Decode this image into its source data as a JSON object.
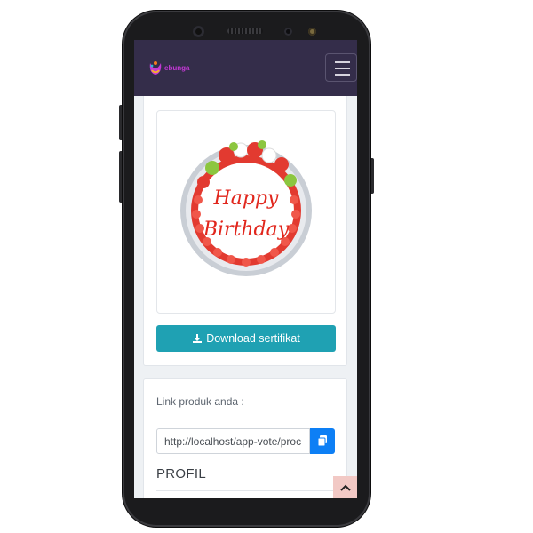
{
  "app": {
    "brand": "ebunga",
    "brand_color": "#c438d6",
    "navbar_color": "#342d4a",
    "menu_icon": "hamburger-icon"
  },
  "certificate": {
    "image_text": "Happy Birthday",
    "download_label": "Download sertifikat",
    "download_icon": "download-icon",
    "button_color": "#1fa1b3"
  },
  "product_link": {
    "label": "Link produk anda :",
    "url_value": "http://localhost/app-vote/proc",
    "copy_icon": "copy-icon",
    "copy_color": "#0d7ff5"
  },
  "profile": {
    "title": "PROFIL"
  },
  "scroll_top": {
    "icon": "chevron-up-icon"
  }
}
